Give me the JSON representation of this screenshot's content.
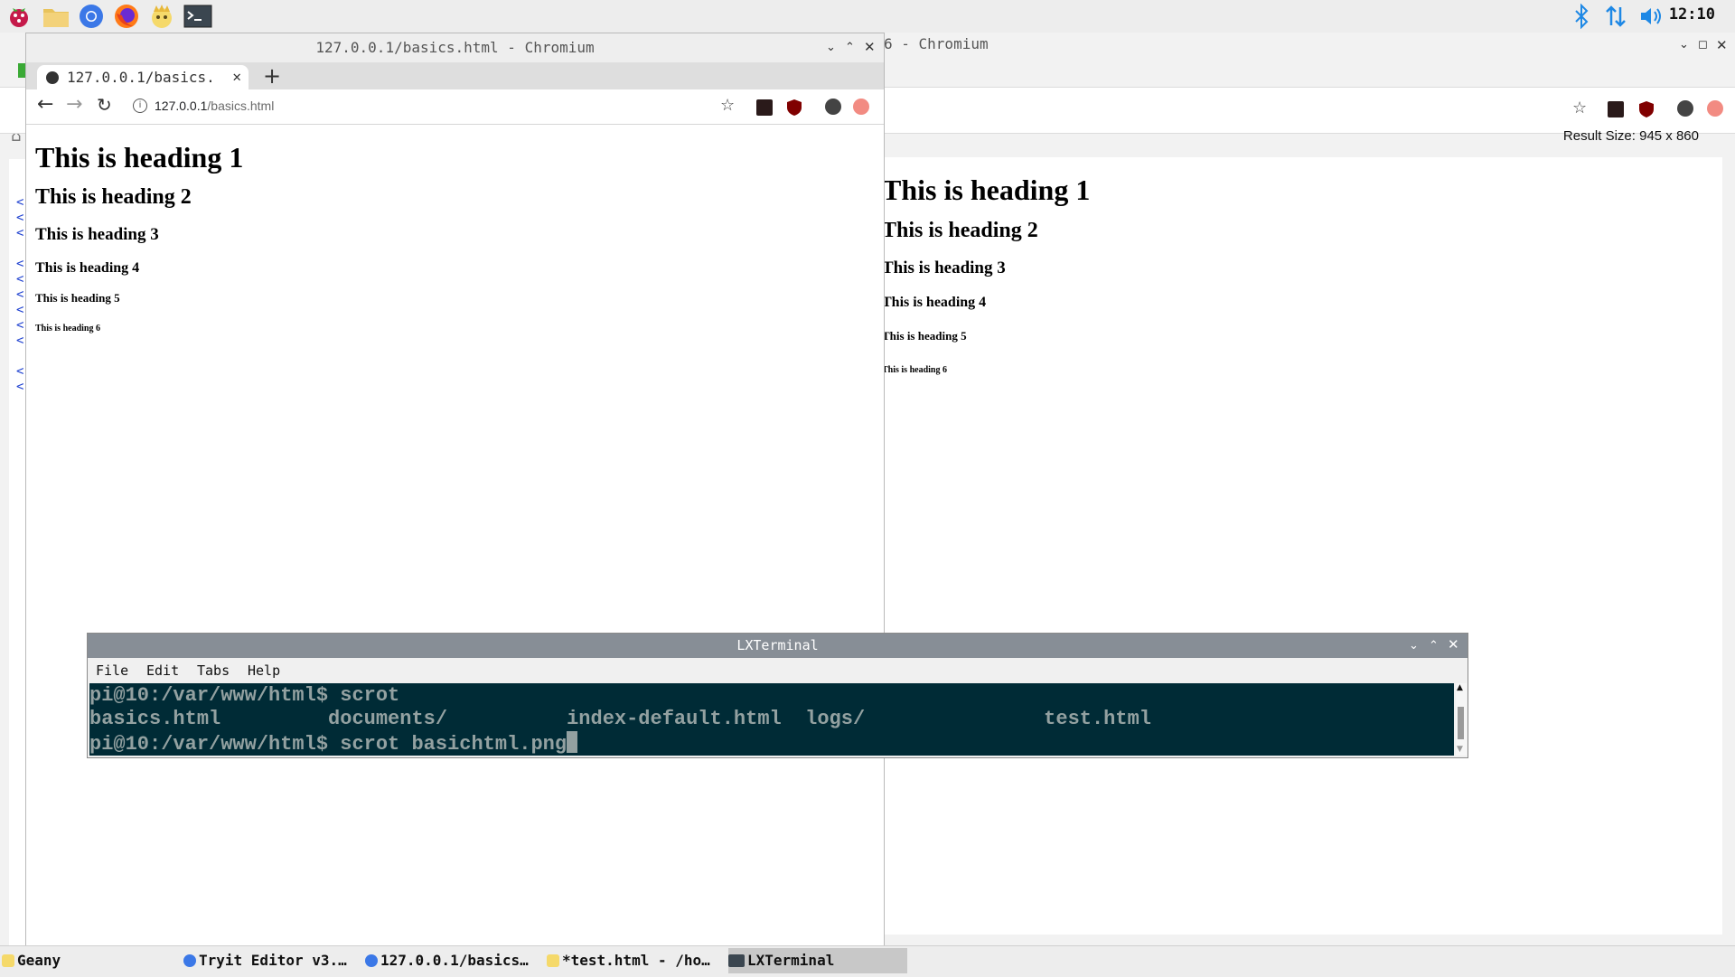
{
  "panel": {
    "launchers": [
      "raspberry-menu",
      "file-manager",
      "chromium",
      "firefox",
      "geany",
      "terminal"
    ],
    "clock": "12:10"
  },
  "back_window": {
    "title": "6 - Chromium",
    "result_size": "Result Size: 945  x  860",
    "gutter_marks": [
      "<",
      "<",
      "<",
      "<",
      "<",
      "<",
      "<",
      "<",
      "<",
      "<",
      "<"
    ],
    "headings": [
      "This is heading 1",
      "This is heading 2",
      "This is heading 3",
      "This is heading 4",
      "This is heading 5",
      "This is heading 6"
    ]
  },
  "front_window": {
    "title": "127.0.0.1/basics.html - Chromium",
    "tab_label": "127.0.0.1/basics.",
    "url_host": "127.0.0.1",
    "url_path": "/basics.html",
    "headings": [
      "This is heading 1",
      "This is heading 2",
      "This is heading 3",
      "This is heading 4",
      "This is heading 5",
      "This is heading 6"
    ]
  },
  "terminal": {
    "title": "LXTerminal",
    "menu": [
      "File",
      "Edit",
      "Tabs",
      "Help"
    ],
    "lines": [
      "pi@10:/var/www/html$ scrot",
      "basics.html         documents/          index-default.html  logs/               test.html",
      "pi@10:/var/www/html$ scrot basichtml.png"
    ]
  },
  "taskbar": {
    "items": [
      "Geany",
      "Tryit Editor v3.…",
      "127.0.0.1/basics…",
      "*test.html - /ho…",
      "LXTerminal"
    ]
  },
  "colors": {
    "terminal_bg": "#002b36",
    "terminal_fg": "#93a1a1",
    "tray_blue": "#1e88e5"
  }
}
